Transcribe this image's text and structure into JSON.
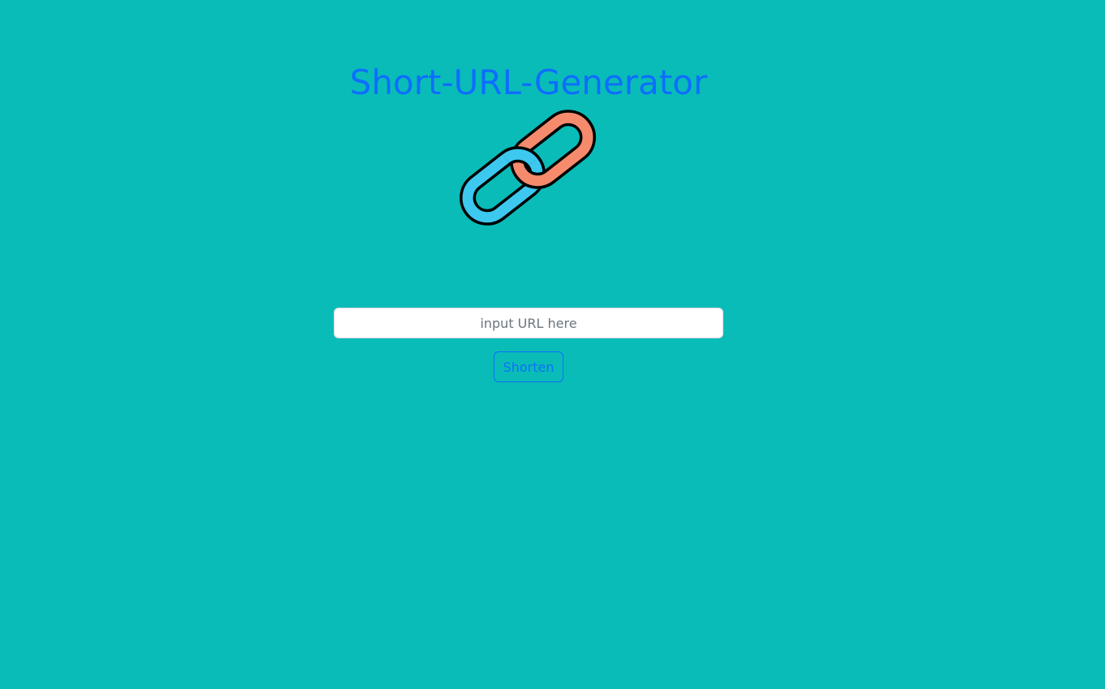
{
  "header": {
    "title": "Short-URL-Generator"
  },
  "logo": {
    "icon": "chain-link-icon",
    "colors": {
      "link_left": "#3cc8ef",
      "link_right": "#f58b6c",
      "outline": "#000000"
    }
  },
  "form": {
    "url_value": "",
    "url_placeholder": "input URL here",
    "submit_label": "Shorten"
  },
  "theme": {
    "background": "#0abcb8",
    "accent": "#0d6efd"
  }
}
